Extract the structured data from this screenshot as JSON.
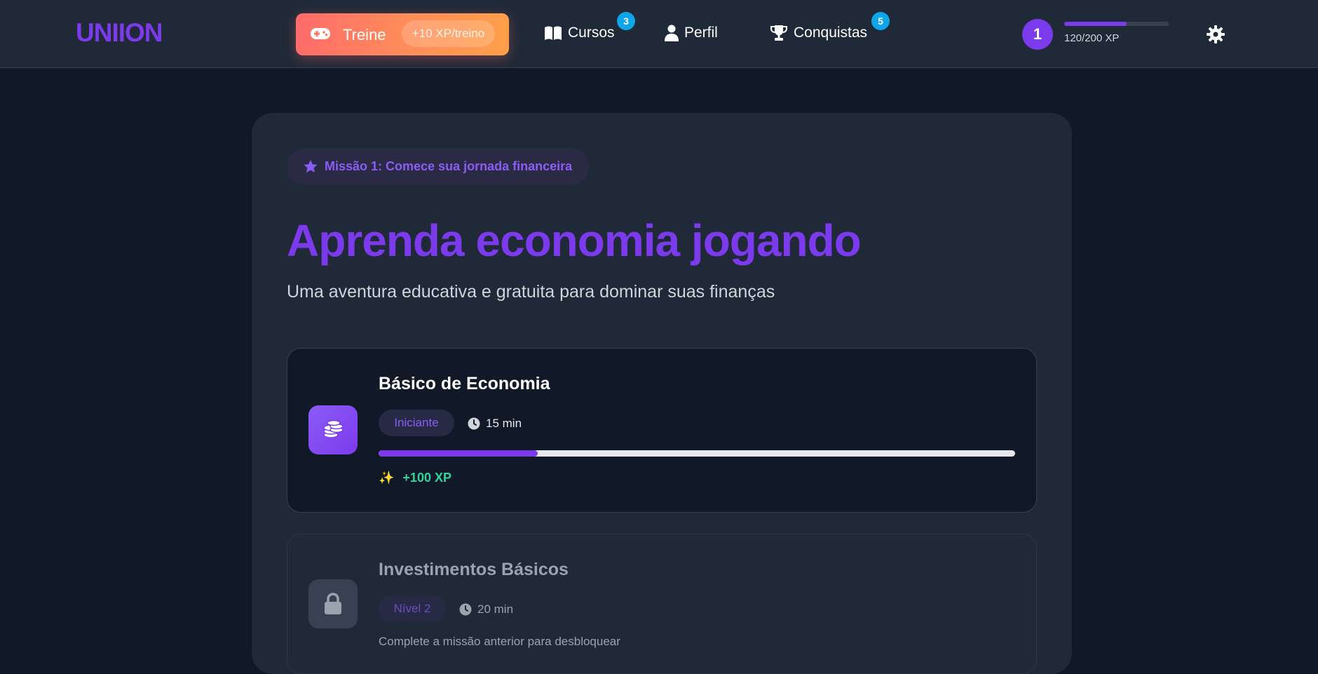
{
  "header": {
    "logo": "UNIION",
    "train_button": {
      "label": "Treine",
      "xp_chip": "+10 XP/treino",
      "icon": "gamepad-icon"
    },
    "nav": [
      {
        "label": "Cursos",
        "icon": "book-icon",
        "badge": "3"
      },
      {
        "label": "Perfil",
        "icon": "user-icon",
        "badge": ""
      },
      {
        "label": "Conquistas",
        "icon": "trophy-icon",
        "badge": "5"
      }
    ],
    "user": {
      "level": "1",
      "xp_text": "120/200 XP",
      "xp_current": 120,
      "xp_max": 200
    },
    "settings_icon": "gear-icon"
  },
  "hero": {
    "mission": "Missão 1: Comece sua jornada financeira",
    "mission_icon": "star-icon",
    "title": "Aprenda economia jogando",
    "subtitle": "Uma aventura educativa e gratuita para dominar suas finanças"
  },
  "courses": [
    {
      "title": "Básico de Economia",
      "level": "Iniciante",
      "duration": "15 min",
      "progress": 0.25,
      "reward": "+100 XP",
      "icon": "coins-icon",
      "locked": false
    },
    {
      "title": "Investimentos Básicos",
      "level": "Nível 2",
      "duration": "20 min",
      "locked_message": "Complete a missão anterior para desbloquear",
      "icon": "lock-icon",
      "locked": true
    }
  ],
  "colors": {
    "accent": "#7c3aed",
    "background": "#111827",
    "surface": "#1f2937",
    "badge": "#0ea5e9",
    "reward": "#34d399",
    "train_gradient_start": "#ff6b6b",
    "train_gradient_end": "#ff9f4a"
  }
}
